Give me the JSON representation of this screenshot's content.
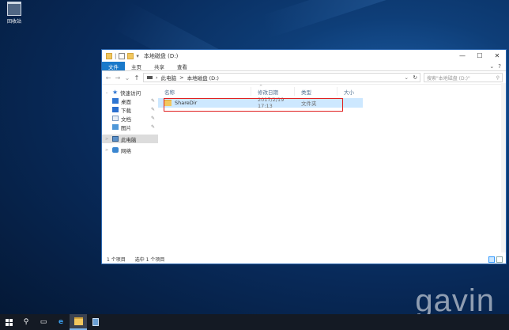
{
  "desktop": {
    "recycle_bin_label": "回收站",
    "watermark": "gavin"
  },
  "window": {
    "title": "本地磁盘 (D:)",
    "controls": {
      "minimize": "—",
      "maximize": "☐",
      "close": "✕"
    }
  },
  "ribbon": {
    "tabs": [
      {
        "label": "文件",
        "active": true
      },
      {
        "label": "主页"
      },
      {
        "label": "共享"
      },
      {
        "label": "查看"
      }
    ],
    "expand_glyph": "⌄",
    "help_glyph": "?"
  },
  "address_bar": {
    "path": [
      "此电脑",
      "本地磁盘 (D:)"
    ],
    "separator": ">",
    "search_placeholder": "搜索\"本地磁盘 (D:)\""
  },
  "nav_pane": {
    "items": [
      {
        "label": "快速访问",
        "icon": "star-icon",
        "expand": "⌄",
        "pinned": false
      },
      {
        "label": "桌面",
        "icon": "desktop-icon",
        "pinned": true
      },
      {
        "label": "下载",
        "icon": "download-icon",
        "pinned": true
      },
      {
        "label": "文档",
        "icon": "documents-icon",
        "pinned": true
      },
      {
        "label": "图片",
        "icon": "pictures-icon",
        "pinned": true
      },
      {
        "label": "此电脑",
        "icon": "this-pc-icon",
        "expand": ">",
        "selected": true
      },
      {
        "label": "网络",
        "icon": "network-icon",
        "expand": ">"
      }
    ]
  },
  "file_list": {
    "columns": [
      "名称",
      "修改日期",
      "类型",
      "大小"
    ],
    "rows": [
      {
        "name": "ShareDir",
        "modified": "2017/2/19 17:13",
        "type": "文件夹",
        "size": ""
      }
    ]
  },
  "status_bar": {
    "item_count": "1 个项目",
    "selected": "选中 1 个项目"
  },
  "colors": {
    "accent": "#1979ca",
    "selection": "#cde8ff",
    "highlight_box": "#e02020"
  }
}
